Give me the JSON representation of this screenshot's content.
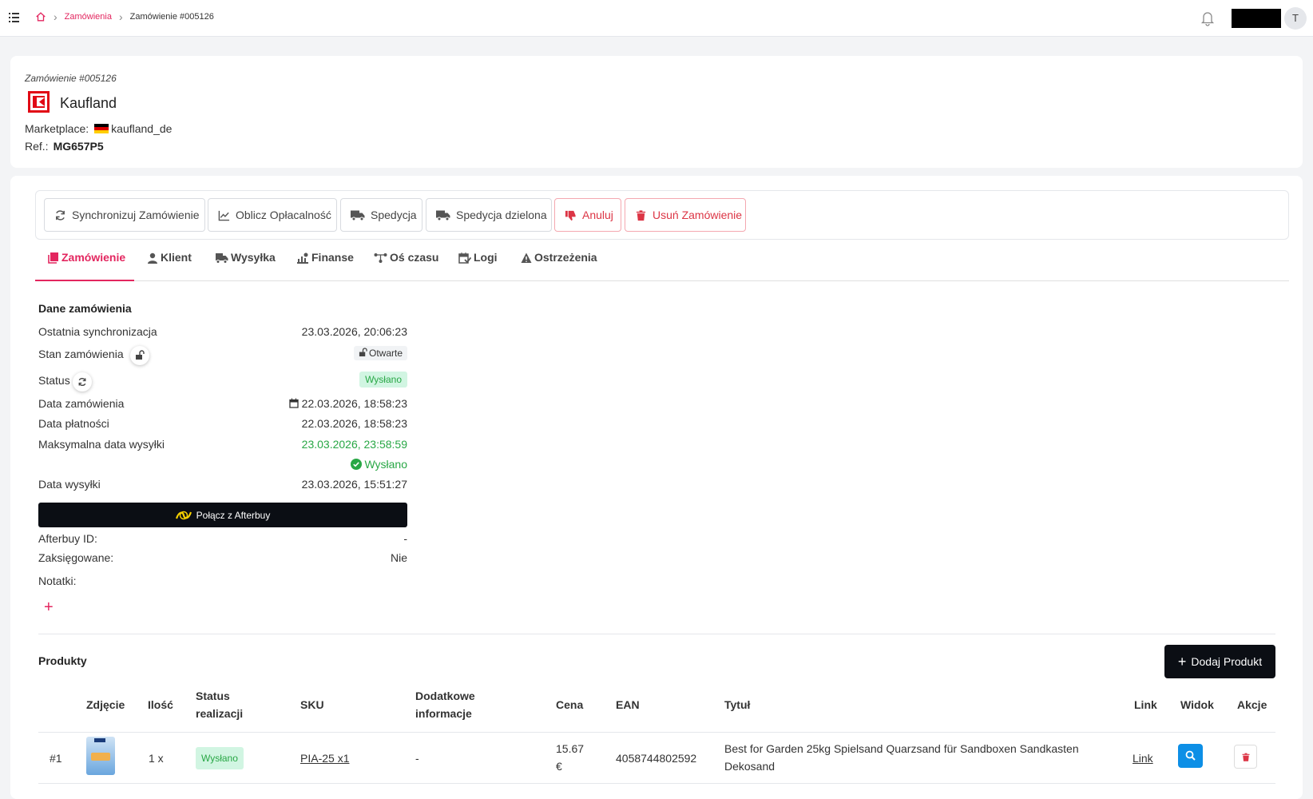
{
  "breadcrumb": {
    "parent": "Zamówienia",
    "current": "Zamówienie #005126"
  },
  "user": {
    "avatar_initial": "T"
  },
  "order": {
    "number_label": "Zamówienie #005126",
    "brand": "Kaufland",
    "marketplace_label": "Marketplace:",
    "marketplace": "kaufland_de",
    "ref_label": "Ref.:",
    "ref": "MG657P5"
  },
  "toolbar": {
    "sync": "Synchronizuj Zamówienie",
    "profit": "Oblicz Opłacalność",
    "ship": "Spedycja",
    "split_ship": "Spedycja dzielona",
    "cancel": "Anuluj",
    "delete": "Usuń Zamówienie"
  },
  "tabs": [
    "Zamówienie",
    "Klient",
    "Wysyłka",
    "Finanse",
    "Oś czasu",
    "Logi",
    "Ostrzeżenia"
  ],
  "details": {
    "title": "Dane zamówienia",
    "last_sync_label": "Ostatnia synchronizacja",
    "last_sync": "23.03.2026, 20:06:23",
    "state_label": "Stan zamówienia",
    "state": "Otwarte",
    "status_label": "Status",
    "status": "Wysłano",
    "order_date_label": "Data zamówienia",
    "order_date": "22.03.2026, 18:58:23",
    "payment_date_label": "Data płatności",
    "payment_date": "22.03.2026, 18:58:23",
    "max_ship_label": "Maksymalna data wysyłki",
    "max_ship": "23.03.2026, 23:58:59",
    "max_ship_status": "Wysłano",
    "ship_date_label": "Data wysyłki",
    "ship_date": "23.03.2026, 15:51:27",
    "afterbuy_button": "Połącz z Afterbuy",
    "afterbuy_id_label": "Afterbuy ID:",
    "afterbuy_id": "-",
    "booked_label": "Zaksięgowane:",
    "booked": "Nie",
    "notes_label": "Notatki:",
    "add_note": "+"
  },
  "products": {
    "title": "Produkty",
    "add_button": "Dodaj Produkt",
    "add_icon": "+",
    "headers": {
      "photo": "Zdjęcie",
      "qty": "Ilość",
      "status_line1": "Status",
      "status_line2": "realizacji",
      "sku": "SKU",
      "extra_line1": "Dodatkowe",
      "extra_line2": "informacje",
      "price": "Cena",
      "ean": "EAN",
      "title": "Tytuł",
      "link": "Link",
      "view": "Widok",
      "actions": "Akcje"
    },
    "rows": [
      {
        "index": "#1",
        "qty": "1 x",
        "status": "Wysłano",
        "sku": "PIA-25 x1",
        "extra": "-",
        "price_value": "15.67",
        "price_currency": "€",
        "ean": "4058744802592",
        "title_line1": "Best for Garden 25kg Spielsand Quarzsand für Sandboxen Sandkasten",
        "title_line2": "Dekosand",
        "link": "Link"
      }
    ]
  }
}
